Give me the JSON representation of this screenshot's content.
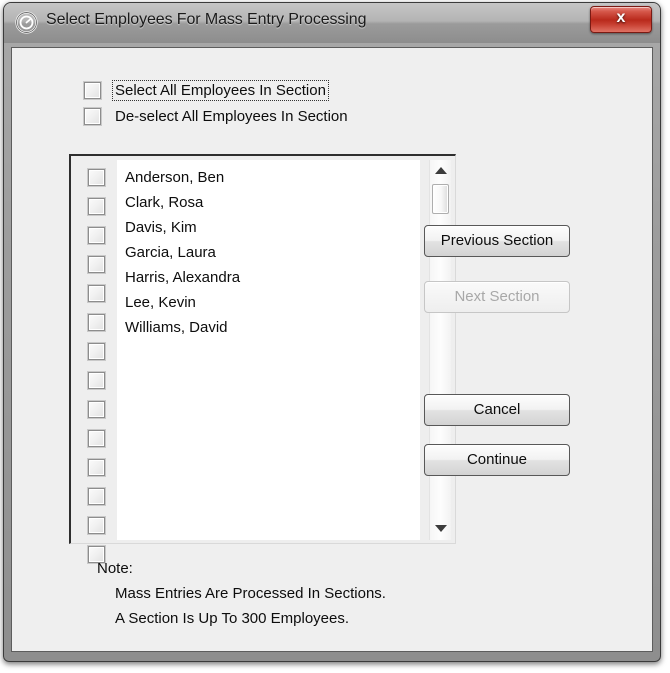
{
  "window": {
    "title": "Select Employees For Mass Entry Processing",
    "app_icon": "copyright-circle-icon",
    "close_label": "x",
    "accent_close": "#b92a1c"
  },
  "top_options": [
    {
      "label": "Select All Employees In Section",
      "checked": false,
      "focused": true
    },
    {
      "label": "De-select All Employees In Section",
      "checked": false,
      "focused": false
    }
  ],
  "employee_list": {
    "rows": [
      {
        "name": "Anderson, Ben",
        "checked": false
      },
      {
        "name": "Clark, Rosa",
        "checked": false
      },
      {
        "name": "Davis, Kim",
        "checked": false
      },
      {
        "name": "Garcia, Laura",
        "checked": false
      },
      {
        "name": "Harris, Alexandra",
        "checked": false
      },
      {
        "name": "Lee, Kevin",
        "checked": false
      },
      {
        "name": "Williams, David",
        "checked": false
      },
      {
        "name": "",
        "checked": false
      },
      {
        "name": "",
        "checked": false
      },
      {
        "name": "",
        "checked": false
      },
      {
        "name": "",
        "checked": false
      },
      {
        "name": "",
        "checked": false
      },
      {
        "name": "",
        "checked": false
      },
      {
        "name": "",
        "checked": false
      }
    ]
  },
  "buttons": {
    "previous_section": {
      "label": "Previous Section",
      "enabled": true
    },
    "next_section": {
      "label": "Next Section",
      "enabled": false
    },
    "cancel": {
      "label": "Cancel",
      "enabled": true
    },
    "continue": {
      "label": "Continue",
      "enabled": true
    }
  },
  "note": {
    "heading": "Note:",
    "line1": "Mass Entries Are Processed In Sections.",
    "line2": "A Section Is Up To 300 Employees."
  }
}
